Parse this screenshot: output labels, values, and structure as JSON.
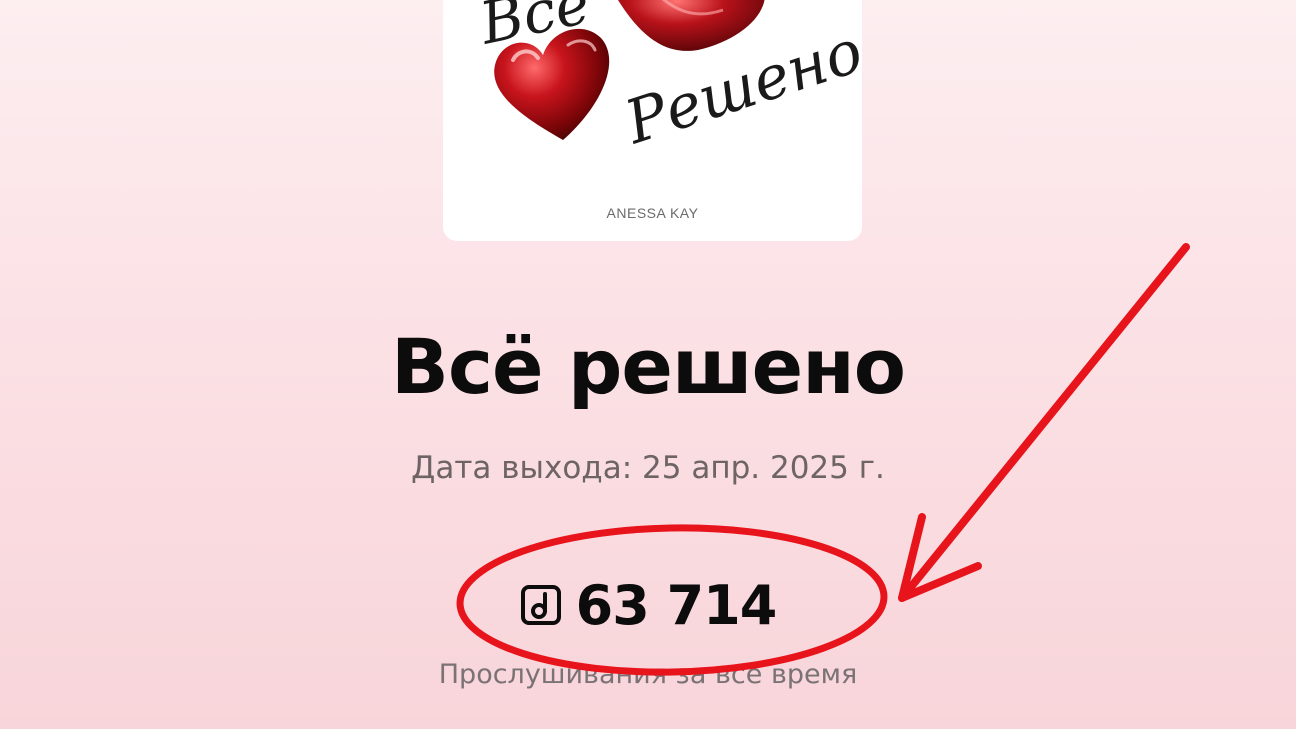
{
  "cover": {
    "title_script_top": "Всё",
    "title_script_bottom": "Решено",
    "author": "ANESSA KAY"
  },
  "album": {
    "title": "Всё решено",
    "release_date": "Дата выхода: 25 апр. 2025 г."
  },
  "stats": {
    "icon": "music-note-square-icon",
    "plays_count": "63 714",
    "plays_label": "Прослушивания за все время"
  },
  "annotation": {
    "color": "#e8141c"
  }
}
